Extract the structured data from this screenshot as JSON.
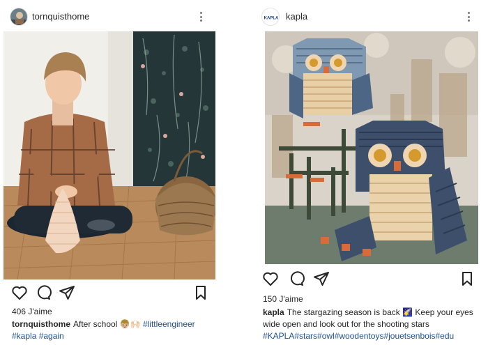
{
  "posts": [
    {
      "username": "tornquisthome",
      "likes": "406 J'aime",
      "caption": {
        "username": "tornquisthome",
        "text": "After school",
        "emoji": "👦🏼🙌🏻",
        "hashtags_line1": "#littleengineer",
        "hashtags_line2": "#kapla #again"
      },
      "photo": "boy-playing-with-kapla-blocks"
    },
    {
      "username": "kapla",
      "avatar_text": "KAPLA",
      "likes": "150 J'aime",
      "caption": {
        "username": "kapla",
        "text": "The stargazing season is back",
        "emoji": "🌠",
        "text2": "Keep your eyes wide open and look out for the shooting stars",
        "hashtags": "#KAPLA#stars#owl#woodentoys#jouetsenbois#edu"
      },
      "photo": "kapla-owl-sculptures"
    }
  ],
  "icons": [
    "heart-icon",
    "comment-icon",
    "share-icon",
    "bookmark-icon",
    "more-options-icon"
  ],
  "colors": {
    "hashtag": "#1f4f8f",
    "text": "#262626",
    "icon": "#262626"
  }
}
